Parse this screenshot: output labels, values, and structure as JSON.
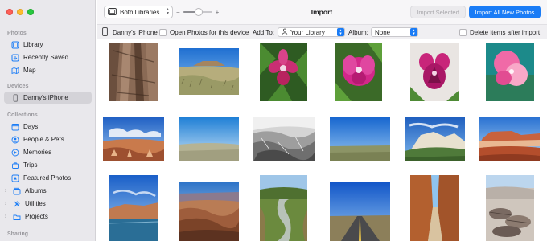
{
  "window": {
    "title": "Import"
  },
  "toolbar": {
    "library_select": "Both Libraries",
    "zoom_minus": "−",
    "zoom_plus": "+",
    "zoom_level": 0.55,
    "import_selected_label": "Import Selected",
    "import_all_label": "Import All New Photos"
  },
  "importbar": {
    "device_name": "Danny's iPhone",
    "open_photos_label": "Open Photos for this device",
    "add_to_label": "Add To:",
    "add_to_value": "Your Library",
    "album_label": "Album:",
    "album_value": "None",
    "delete_label": "Delete items after import"
  },
  "sidebar": {
    "sections": {
      "photos": "Photos",
      "devices": "Devices",
      "collections": "Collections",
      "sharing": "Sharing"
    },
    "photos_items": [
      {
        "label": "Library",
        "icon": "library-icon"
      },
      {
        "label": "Recently Saved",
        "icon": "recently-saved-icon"
      },
      {
        "label": "Map",
        "icon": "map-icon"
      }
    ],
    "device_items": [
      {
        "label": "Danny's iPhone",
        "icon": "iphone-icon",
        "selected": true
      }
    ],
    "collection_items": [
      {
        "label": "Days",
        "icon": "calendar-icon"
      },
      {
        "label": "People & Pets",
        "icon": "person-icon"
      },
      {
        "label": "Memories",
        "icon": "memories-icon"
      },
      {
        "label": "Trips",
        "icon": "trips-icon"
      },
      {
        "label": "Featured Photos",
        "icon": "featured-icon"
      },
      {
        "label": "Albums",
        "icon": "albums-icon"
      },
      {
        "label": "Utilities",
        "icon": "utilities-icon"
      },
      {
        "label": "Projects",
        "icon": "projects-icon"
      }
    ]
  },
  "colors": {
    "accent": "#1a7cf6",
    "sidebar_bg": "#e9e8ec",
    "selected_bg": "#d4d3d8"
  }
}
